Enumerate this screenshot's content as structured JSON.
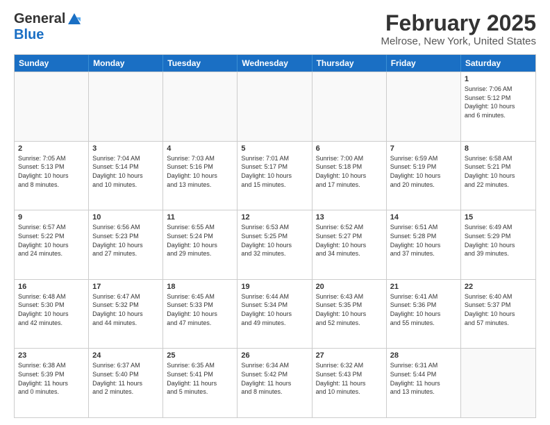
{
  "logo": {
    "general": "General",
    "blue": "Blue"
  },
  "title": "February 2025",
  "location": "Melrose, New York, United States",
  "headers": [
    "Sunday",
    "Monday",
    "Tuesday",
    "Wednesday",
    "Thursday",
    "Friday",
    "Saturday"
  ],
  "rows": [
    [
      {
        "day": "",
        "info": "",
        "empty": true
      },
      {
        "day": "",
        "info": "",
        "empty": true
      },
      {
        "day": "",
        "info": "",
        "empty": true
      },
      {
        "day": "",
        "info": "",
        "empty": true
      },
      {
        "day": "",
        "info": "",
        "empty": true
      },
      {
        "day": "",
        "info": "",
        "empty": true
      },
      {
        "day": "1",
        "info": "Sunrise: 7:06 AM\nSunset: 5:12 PM\nDaylight: 10 hours\nand 6 minutes.",
        "empty": false
      }
    ],
    [
      {
        "day": "2",
        "info": "Sunrise: 7:05 AM\nSunset: 5:13 PM\nDaylight: 10 hours\nand 8 minutes.",
        "empty": false
      },
      {
        "day": "3",
        "info": "Sunrise: 7:04 AM\nSunset: 5:14 PM\nDaylight: 10 hours\nand 10 minutes.",
        "empty": false
      },
      {
        "day": "4",
        "info": "Sunrise: 7:03 AM\nSunset: 5:16 PM\nDaylight: 10 hours\nand 13 minutes.",
        "empty": false
      },
      {
        "day": "5",
        "info": "Sunrise: 7:01 AM\nSunset: 5:17 PM\nDaylight: 10 hours\nand 15 minutes.",
        "empty": false
      },
      {
        "day": "6",
        "info": "Sunrise: 7:00 AM\nSunset: 5:18 PM\nDaylight: 10 hours\nand 17 minutes.",
        "empty": false
      },
      {
        "day": "7",
        "info": "Sunrise: 6:59 AM\nSunset: 5:19 PM\nDaylight: 10 hours\nand 20 minutes.",
        "empty": false
      },
      {
        "day": "8",
        "info": "Sunrise: 6:58 AM\nSunset: 5:21 PM\nDaylight: 10 hours\nand 22 minutes.",
        "empty": false
      }
    ],
    [
      {
        "day": "9",
        "info": "Sunrise: 6:57 AM\nSunset: 5:22 PM\nDaylight: 10 hours\nand 24 minutes.",
        "empty": false
      },
      {
        "day": "10",
        "info": "Sunrise: 6:56 AM\nSunset: 5:23 PM\nDaylight: 10 hours\nand 27 minutes.",
        "empty": false
      },
      {
        "day": "11",
        "info": "Sunrise: 6:55 AM\nSunset: 5:24 PM\nDaylight: 10 hours\nand 29 minutes.",
        "empty": false
      },
      {
        "day": "12",
        "info": "Sunrise: 6:53 AM\nSunset: 5:25 PM\nDaylight: 10 hours\nand 32 minutes.",
        "empty": false
      },
      {
        "day": "13",
        "info": "Sunrise: 6:52 AM\nSunset: 5:27 PM\nDaylight: 10 hours\nand 34 minutes.",
        "empty": false
      },
      {
        "day": "14",
        "info": "Sunrise: 6:51 AM\nSunset: 5:28 PM\nDaylight: 10 hours\nand 37 minutes.",
        "empty": false
      },
      {
        "day": "15",
        "info": "Sunrise: 6:49 AM\nSunset: 5:29 PM\nDaylight: 10 hours\nand 39 minutes.",
        "empty": false
      }
    ],
    [
      {
        "day": "16",
        "info": "Sunrise: 6:48 AM\nSunset: 5:30 PM\nDaylight: 10 hours\nand 42 minutes.",
        "empty": false
      },
      {
        "day": "17",
        "info": "Sunrise: 6:47 AM\nSunset: 5:32 PM\nDaylight: 10 hours\nand 44 minutes.",
        "empty": false
      },
      {
        "day": "18",
        "info": "Sunrise: 6:45 AM\nSunset: 5:33 PM\nDaylight: 10 hours\nand 47 minutes.",
        "empty": false
      },
      {
        "day": "19",
        "info": "Sunrise: 6:44 AM\nSunset: 5:34 PM\nDaylight: 10 hours\nand 49 minutes.",
        "empty": false
      },
      {
        "day": "20",
        "info": "Sunrise: 6:43 AM\nSunset: 5:35 PM\nDaylight: 10 hours\nand 52 minutes.",
        "empty": false
      },
      {
        "day": "21",
        "info": "Sunrise: 6:41 AM\nSunset: 5:36 PM\nDaylight: 10 hours\nand 55 minutes.",
        "empty": false
      },
      {
        "day": "22",
        "info": "Sunrise: 6:40 AM\nSunset: 5:37 PM\nDaylight: 10 hours\nand 57 minutes.",
        "empty": false
      }
    ],
    [
      {
        "day": "23",
        "info": "Sunrise: 6:38 AM\nSunset: 5:39 PM\nDaylight: 11 hours\nand 0 minutes.",
        "empty": false
      },
      {
        "day": "24",
        "info": "Sunrise: 6:37 AM\nSunset: 5:40 PM\nDaylight: 11 hours\nand 2 minutes.",
        "empty": false
      },
      {
        "day": "25",
        "info": "Sunrise: 6:35 AM\nSunset: 5:41 PM\nDaylight: 11 hours\nand 5 minutes.",
        "empty": false
      },
      {
        "day": "26",
        "info": "Sunrise: 6:34 AM\nSunset: 5:42 PM\nDaylight: 11 hours\nand 8 minutes.",
        "empty": false
      },
      {
        "day": "27",
        "info": "Sunrise: 6:32 AM\nSunset: 5:43 PM\nDaylight: 11 hours\nand 10 minutes.",
        "empty": false
      },
      {
        "day": "28",
        "info": "Sunrise: 6:31 AM\nSunset: 5:44 PM\nDaylight: 11 hours\nand 13 minutes.",
        "empty": false
      },
      {
        "day": "",
        "info": "",
        "empty": true
      }
    ]
  ]
}
